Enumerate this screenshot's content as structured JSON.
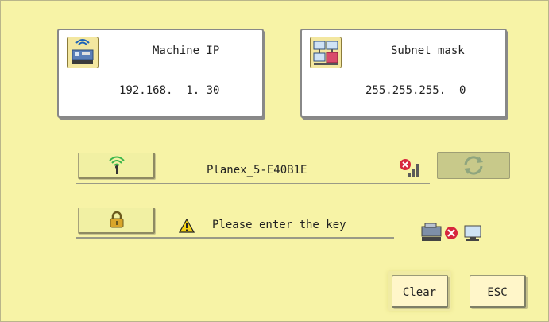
{
  "machine_ip": {
    "title": "Machine IP",
    "value": "192.168.  1. 30",
    "icon": "network-machine-icon"
  },
  "subnet_mask": {
    "title": "Subnet mask",
    "value": "255.255.255.  0",
    "icon": "subnet-network-icon"
  },
  "wifi": {
    "network_name": "Planex_5-E40B1E",
    "button_icon": "wifi-antenna-icon",
    "signal_icon": "signal-disconnected-icon",
    "refresh_icon": "refresh-icon"
  },
  "key": {
    "message": "Please enter the key",
    "button_icon": "padlock-icon",
    "warning_icon": "warning-icon",
    "status_icon": "machine-disconnected-pc-icon"
  },
  "buttons": {
    "clear": "Clear",
    "esc": "ESC"
  },
  "colors": {
    "background": "#f7f3a6",
    "error_red": "#d7263d",
    "accent_green": "#39b54a"
  }
}
